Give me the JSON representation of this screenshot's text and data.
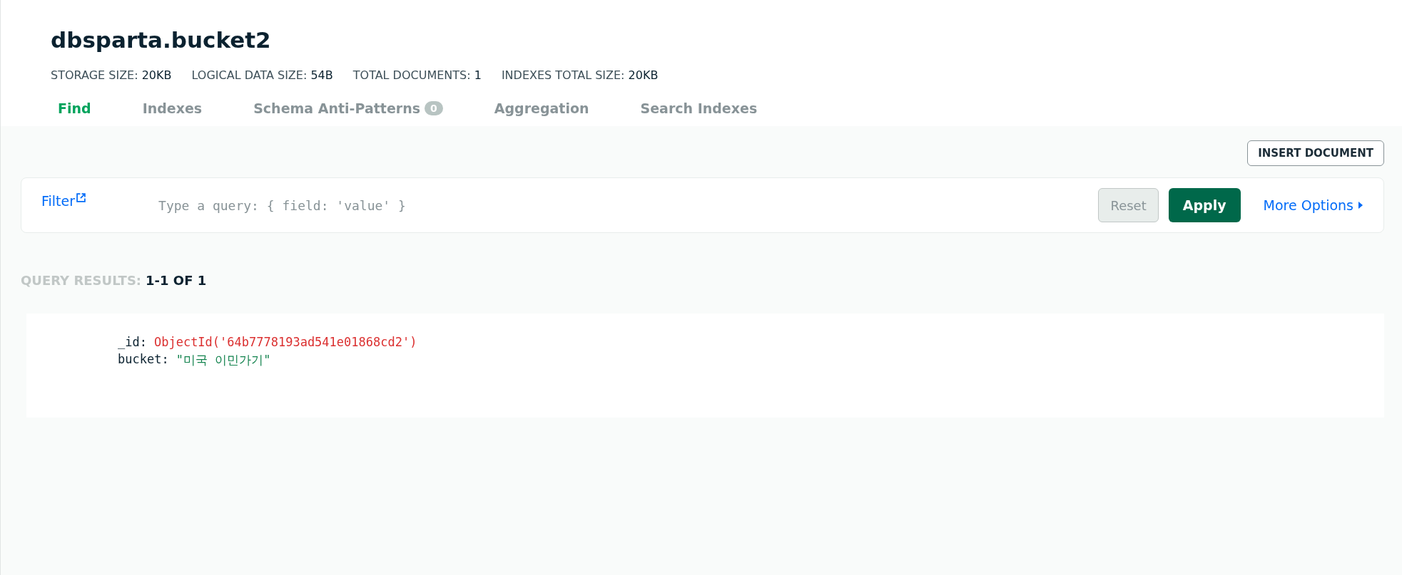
{
  "collection": {
    "title": "dbsparta.bucket2",
    "stats": [
      {
        "label": "STORAGE SIZE:",
        "value": "20KB"
      },
      {
        "label": "LOGICAL DATA SIZE:",
        "value": "54B"
      },
      {
        "label": "TOTAL DOCUMENTS:",
        "value": "1"
      },
      {
        "label": "INDEXES TOTAL SIZE:",
        "value": "20KB"
      }
    ]
  },
  "tabs": [
    {
      "label": "Find",
      "selected": true
    },
    {
      "label": "Indexes",
      "selected": false
    },
    {
      "label": "Schema Anti-Patterns",
      "selected": false,
      "badge": "0"
    },
    {
      "label": "Aggregation",
      "selected": false
    },
    {
      "label": "Search Indexes",
      "selected": false
    }
  ],
  "insert_button": "INSERT DOCUMENT",
  "filter": {
    "label": "Filter",
    "placeholder": "Type a query: { field: 'value' }",
    "reset": "Reset",
    "apply": "Apply",
    "more_options": "More Options"
  },
  "results": {
    "label": "QUERY RESULTS:",
    "count": "1-1 OF 1"
  },
  "documents": [
    {
      "fields": [
        {
          "key": "_id:",
          "value": "ObjectId('64b7778193ad541e01868cd2')",
          "kind": "objectid"
        },
        {
          "key": "bucket:",
          "value": "\"미국 이민가기\"",
          "kind": "string"
        }
      ]
    }
  ]
}
